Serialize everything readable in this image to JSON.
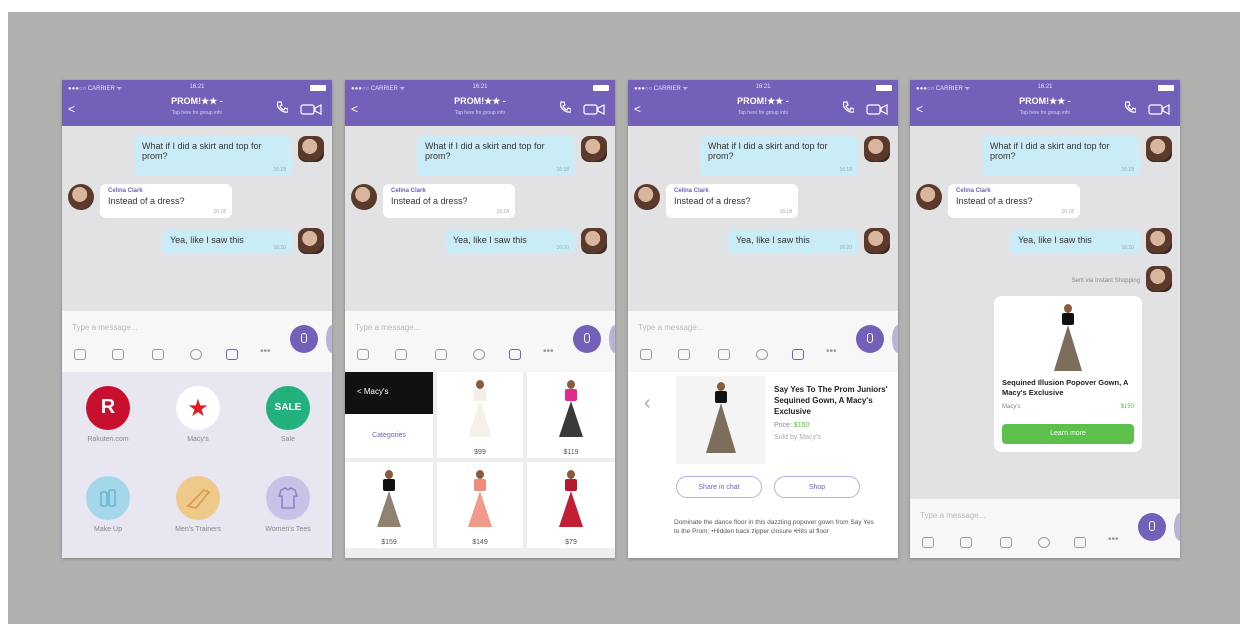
{
  "chat": {
    "carrier": "●●●○○ CARRIER ᯤ",
    "time": "16:21",
    "title": "PROM!★★ -",
    "subtitle": "Tap here for group info",
    "back": "<",
    "msg1": "What if I did a skirt and top for prom?",
    "msg1_time": "16:18",
    "sender": "Celina Clark",
    "msg2": "Instead of a dress?",
    "msg2_time": "16:18",
    "msg3": "Yea, like I saw this",
    "msg3_time": "16:20",
    "input_placeholder": "Type a message...",
    "sent_via": "Sent via Instant Shopping"
  },
  "stores": [
    {
      "label": "Rakuten.com",
      "glyph": "R",
      "color": "#c8102e",
      "glyph_color": "#ffffff"
    },
    {
      "label": "Macy's",
      "glyph": "★",
      "color": "#ffffff",
      "glyph_color": "#e21a22"
    },
    {
      "label": "Sale",
      "glyph": "SALE",
      "color": "#22b07d",
      "glyph_color": "#ffffff"
    },
    {
      "label": "Make Up",
      "glyph": "",
      "color": "#a5d7ea",
      "glyph_color": "#6ab3cf"
    },
    {
      "label": "Men's Trainers",
      "glyph": "",
      "color": "#efc98a",
      "glyph_color": "#d8a04f"
    },
    {
      "label": "Women's Tees",
      "glyph": "",
      "color": "#c7c2e8",
      "glyph_color": "#8f86c6"
    }
  ],
  "grid": {
    "back_label": "< Macy's",
    "categories_label": "Categories",
    "prices": [
      "$99",
      "$119",
      "$159",
      "$149",
      "$79"
    ]
  },
  "product": {
    "name": "Say Yes To The Prom Juniors' Sequined Gown, A Macy's Exclusive",
    "price_label": "Price:",
    "price": "$150",
    "sold_by": "Sold by Macy's",
    "share_label": "Share in chat",
    "shop_label": "Shop",
    "description": "Dominate the dance floor in this dazzling popover gown from Say Yes to the Prom: •Hidden back zipper closure •Hits at floor"
  },
  "card": {
    "name": "Sequined Illusion Popover Gown, A Macy's Exclusive",
    "store": "Macy's",
    "price": "$150",
    "button": "Learn more"
  },
  "colors": {
    "accent": "#7360b8",
    "bubble_out": "#c9ecf7",
    "green": "#5cc04a"
  }
}
